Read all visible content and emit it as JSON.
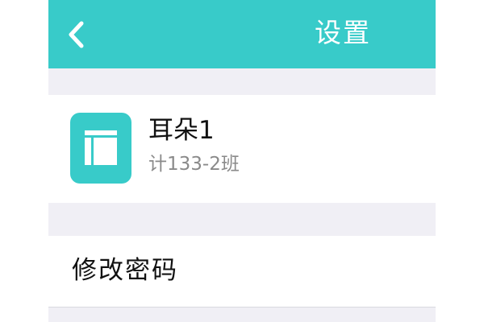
{
  "header": {
    "title": "设置",
    "back_icon": "chevron-left-icon",
    "background_color": "#38cbc9"
  },
  "profile": {
    "icon": "app-grid-icon",
    "name": "耳朵1",
    "class_name": "计133-2班"
  },
  "settings": {
    "items": [
      {
        "label": "修改密码"
      }
    ]
  }
}
